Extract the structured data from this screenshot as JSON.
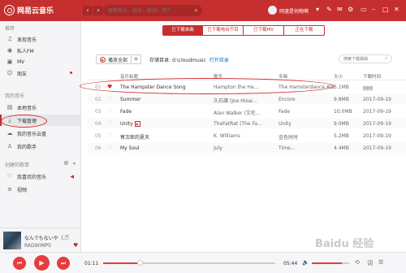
{
  "app": {
    "logo_text": "网易云音乐",
    "search_placeholder": "搜索音乐，歌手，歌词，用户",
    "username": "网速是何物啊",
    "accent": "#c62f2f"
  },
  "sidebar": {
    "section_recommend": "推荐",
    "recommend_items": [
      {
        "label": "发现音乐",
        "icon": "music-note-icon"
      },
      {
        "label": "私人FM",
        "icon": "radio-icon"
      },
      {
        "label": "MV",
        "icon": "video-icon"
      },
      {
        "label": "朋友",
        "icon": "friends-icon"
      }
    ],
    "section_my_music": "我的音乐",
    "my_music_items": [
      {
        "label": "本地音乐",
        "icon": "local-music-icon"
      },
      {
        "label": "下载管理",
        "icon": "download-icon"
      },
      {
        "label": "我的音乐云盘",
        "icon": "cloud-icon"
      },
      {
        "label": "我的歌手",
        "icon": "singer-icon"
      }
    ],
    "section_created": "创建的歌单",
    "created_items": [
      {
        "label": "我喜欢的音乐",
        "icon": "heart-icon"
      },
      {
        "label": "视频",
        "icon": "video-list-icon"
      }
    ]
  },
  "now_playing": {
    "title": "なんでもないや（…",
    "artist": "RADWIMPS"
  },
  "tabs": [
    "已下载单曲",
    "已下载电台节目",
    "已下载MV",
    "正在下载"
  ],
  "actions": {
    "play_all": "播放全部",
    "add": "+",
    "store_label": "存储目录: d:\\cloudmusic",
    "open_dir": "打开目录",
    "local_search_placeholder": "搜索下载歌曲"
  },
  "table": {
    "headers": {
      "title": "音乐标题",
      "artist": "歌手",
      "album": "专辑",
      "size": "大小",
      "time": "下载时间"
    },
    "rows": [
      {
        "num": "01",
        "liked": true,
        "title": "The Hampster Dance Song",
        "mv": false,
        "artist": "Hampton the Ha…",
        "album": "The Hamsterdance Album",
        "size": "5.1MB",
        "time": "刚刚"
      },
      {
        "num": "02",
        "liked": false,
        "title": "Summer",
        "mv": false,
        "artist": "久石譲 (Joe Hisai…",
        "album": "Encore",
        "size": "9.8MB",
        "time": "2017-09-19"
      },
      {
        "num": "03",
        "liked": false,
        "title": "Fade",
        "mv": false,
        "artist": "Alan Walker (艾伦…",
        "album": "Fade",
        "size": "10.0MB",
        "time": "2017-09-19"
      },
      {
        "num": "04",
        "liked": false,
        "title": "Unity",
        "mv": true,
        "artist": "TheFatRat (The Fa…",
        "album": "Unity",
        "size": "9.0MB",
        "time": "2017-09-19"
      },
      {
        "num": "05",
        "liked": false,
        "title": "寄次郎的夏天",
        "mv": false,
        "artist": "K. Williams",
        "album": "金色时时",
        "size": "5.2MB",
        "time": "2017-09-19"
      },
      {
        "num": "06",
        "liked": false,
        "title": "My Soul",
        "mv": false,
        "artist": "July",
        "album": "Time...",
        "size": "4.4MB",
        "time": "2017-09-19"
      }
    ]
  },
  "player": {
    "elapsed": "01:11",
    "duration": "05:44",
    "progress": 0.21,
    "volume": 0.8
  },
  "watermark": "Baidu 经验"
}
